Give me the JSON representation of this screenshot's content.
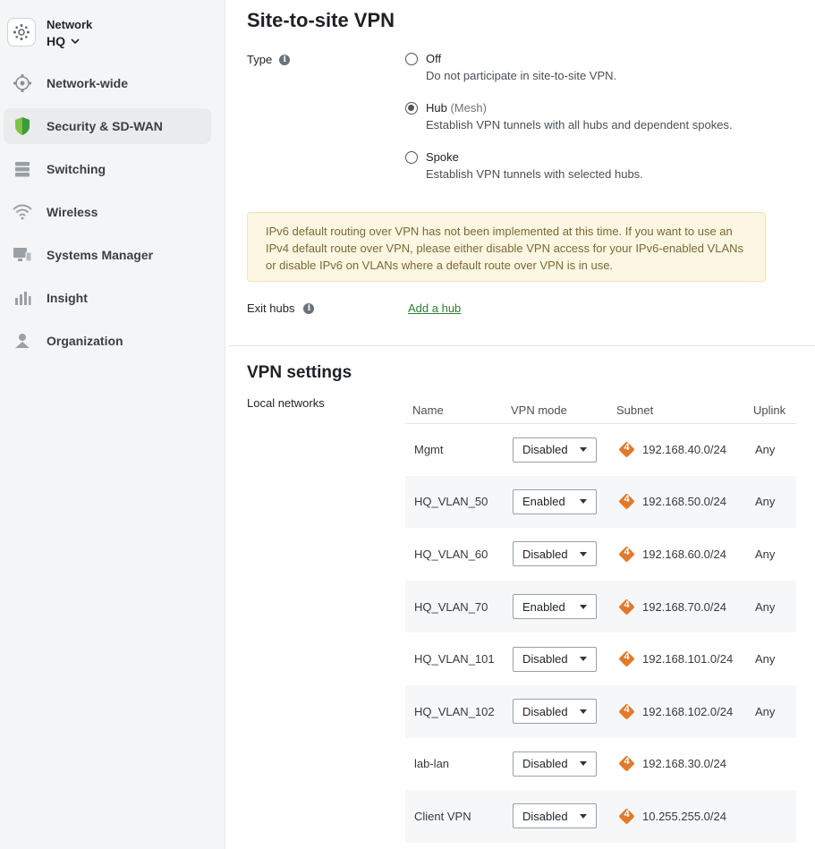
{
  "sidebar": {
    "network_label": "Network",
    "network_name": "HQ",
    "items": [
      {
        "label": "Network-wide",
        "icon": "network-wide-icon"
      },
      {
        "label": "Security & SD-WAN",
        "icon": "shield-icon",
        "active": true
      },
      {
        "label": "Switching",
        "icon": "switch-icon"
      },
      {
        "label": "Wireless",
        "icon": "wifi-icon"
      },
      {
        "label": "Systems Manager",
        "icon": "monitor-icon"
      },
      {
        "label": "Insight",
        "icon": "bar-chart-icon"
      },
      {
        "label": "Organization",
        "icon": "organization-icon"
      }
    ]
  },
  "page": {
    "title": "Site-to-site VPN",
    "type_label": "Type",
    "type_options": [
      {
        "title": "Off",
        "muted": "",
        "desc": "Do not participate in site-to-site VPN.",
        "checked": false
      },
      {
        "title": "Hub",
        "muted": " (Mesh)",
        "desc": "Establish VPN tunnels with all hubs and dependent spokes.",
        "checked": true
      },
      {
        "title": "Spoke",
        "muted": "",
        "desc": "Establish VPN tunnels with selected hubs.",
        "checked": false
      }
    ],
    "warning": "IPv6 default routing over VPN has not been implemented at this time. If you want to use an IPv4 default route over VPN, please either disable VPN access for your IPv6-enabled VLANs or disable IPv6 on VLANs where a default route over VPN is in use.",
    "exit_hubs_label": "Exit hubs",
    "add_hub_link": "Add a hub"
  },
  "vpn_settings": {
    "title": "VPN settings",
    "local_networks_label": "Local networks",
    "columns": [
      "Name",
      "VPN mode",
      "Subnet",
      "Uplink"
    ],
    "ip_version_badge": "4",
    "rows": [
      {
        "name": "Mgmt",
        "mode": "Disabled",
        "subnet": "192.168.40.0/24",
        "uplink": "Any"
      },
      {
        "name": "HQ_VLAN_50",
        "mode": "Enabled",
        "subnet": "192.168.50.0/24",
        "uplink": "Any"
      },
      {
        "name": "HQ_VLAN_60",
        "mode": "Disabled",
        "subnet": "192.168.60.0/24",
        "uplink": "Any"
      },
      {
        "name": "HQ_VLAN_70",
        "mode": "Enabled",
        "subnet": "192.168.70.0/24",
        "uplink": "Any"
      },
      {
        "name": "HQ_VLAN_101",
        "mode": "Disabled",
        "subnet": "192.168.101.0/24",
        "uplink": "Any"
      },
      {
        "name": "HQ_VLAN_102",
        "mode": "Disabled",
        "subnet": "192.168.102.0/24",
        "uplink": "Any"
      },
      {
        "name": "lab-lan",
        "mode": "Disabled",
        "subnet": "192.168.30.0/24",
        "uplink": ""
      },
      {
        "name": "Client VPN",
        "mode": "Disabled",
        "subnet": "10.255.255.0/24",
        "uplink": ""
      }
    ]
  },
  "colors": {
    "accent_green": "#2e7d32",
    "ipv4_badge": "#e07a2c",
    "warning_bg": "#fdf6e2"
  }
}
